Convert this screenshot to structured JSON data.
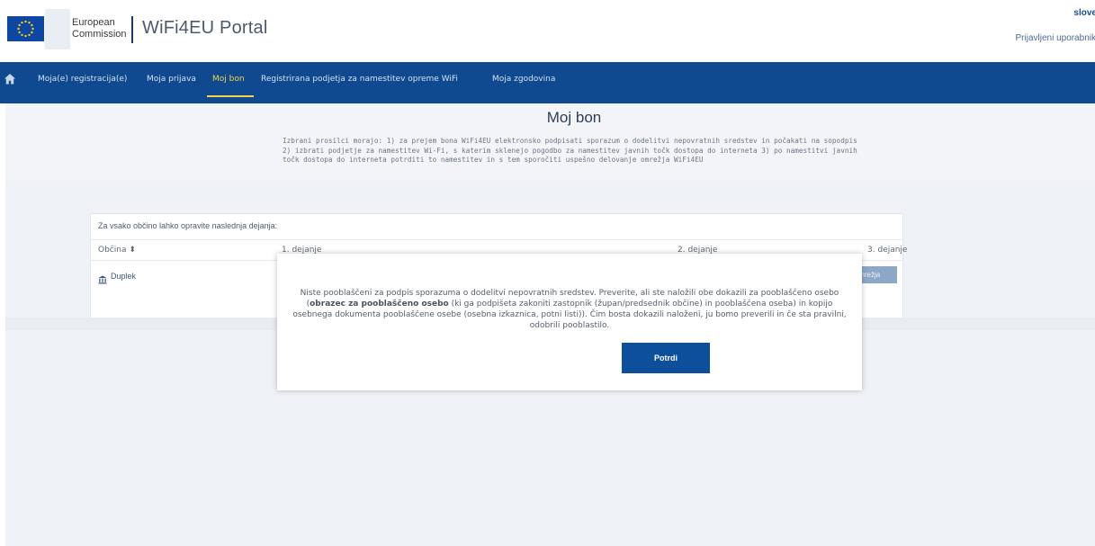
{
  "header": {
    "org_line1": "European",
    "org_line2": "Commission",
    "portal_title": "WiFi4EU Portal",
    "language": "slove",
    "logged_in_user": "Prijavljeni uporabnik"
  },
  "nav": {
    "items": [
      {
        "label": "Moja(e) registracija(e)"
      },
      {
        "label": "Moja prijava"
      },
      {
        "label": "Moj bon"
      },
      {
        "label": "Registrirana podjetja za namestitev opreme WiFi"
      },
      {
        "label": "Moja zgodovina"
      }
    ],
    "active": "Moj bon"
  },
  "main": {
    "title": "Moj bon",
    "intro": "Izbrani prosilci morajo: 1) za prejem bona WiFi4EU elektronsko podpisati sporazum o dodelitvi nepovratnih sredstev in počakati na sopodpis 2) izbrati podjetje za namestitev Wi-Fi, s katerim sklenejo pogodbo za namestitev javnih točk dostopa do interneta 3) po namestitvi javnih točk dostopa do interneta potrditi to namestitev in s tem sporočiti uspešno delovanje omrežja WiFi4EU",
    "table": {
      "caption": "Za vsako občino lahko opravite naslednja dejanja:",
      "columns": [
        "Občina ⬍",
        "1. dejanje",
        "2. dejanje",
        "3. dejanje"
      ],
      "rows": [
        {
          "municipality": "Duplek",
          "action3_button": "Potrdi namestitev omrežja"
        }
      ]
    }
  },
  "modal": {
    "text_part1": "Niste pooblaščeni za podpis sporazuma o dodelitvi nepovratnih sredstev. Preverite, ali ste naložili obe dokazili za pooblaščeno osebo (",
    "text_bold": "obrazec za pooblaščeno osebo",
    "text_part2": " (ki ga podpišeta zakoniti zastopnik (župan/predsednik občine) in pooblaščena oseba) in kopijo osebnega dokumenta pooblaščene osebe (osebna izkaznica, potni listi)). Čim bosta dokazili naloženi, ju bomo preverili in če sta pravilni, odobrili pooblastilo.",
    "confirm_label": "Potrdi"
  },
  "colors": {
    "nav_bg": "#0f4a91",
    "nav_active": "#f4d34a",
    "primary_button": "#0e4f9c",
    "disabled_button": "#8da7c6"
  },
  "icons": [
    "eu-flag-icon",
    "home-icon",
    "municipality-icon"
  ]
}
